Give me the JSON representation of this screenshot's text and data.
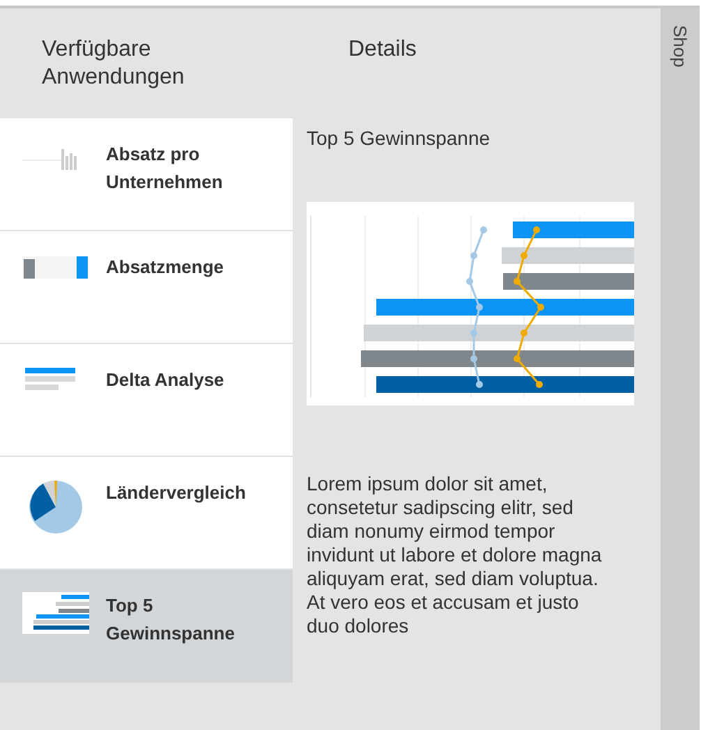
{
  "list_header": "Verfügbare Anwendungen",
  "details_header": "Details",
  "applications": [
    {
      "label": "Absatz pro Unternehmen",
      "kind": "column",
      "selected": false
    },
    {
      "label": "Absatzmenge",
      "kind": "bullet",
      "selected": false
    },
    {
      "label": "Delta Analyse",
      "kind": "delta",
      "selected": false
    },
    {
      "label": "Ländervergleich",
      "kind": "pie",
      "selected": false
    },
    {
      "label": "Top 5 Gewinnspanne",
      "kind": "bars",
      "selected": true
    }
  ],
  "details": {
    "title": "Top 5 Gewinnspanne",
    "description": "Lorem ipsum dolor sit amet, consetetur sadipscing elitr, sed diam nonumy eirmod tempor invidunt ut labore et dolore magna aliquyam erat, sed diam voluptua. At vero eos et accusam et justo duo dolores"
  },
  "side_tab": {
    "label": "Shop"
  }
}
